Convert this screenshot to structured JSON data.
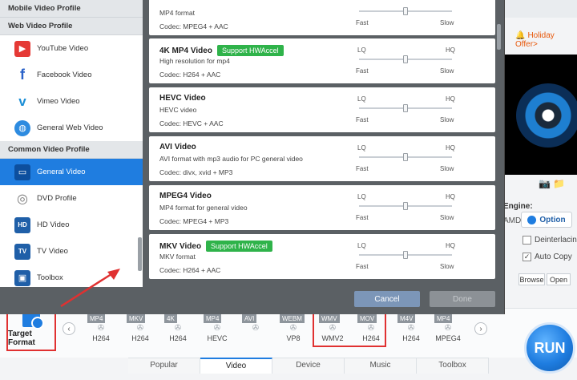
{
  "sidebar": {
    "header_mobile": "Mobile Video Profile",
    "header_web": "Web Video Profile",
    "header_common": "Common Video Profile",
    "web_items": [
      {
        "label": "YouTube Video",
        "icon": "youtube-icon"
      },
      {
        "label": "Facebook Video",
        "icon": "facebook-icon"
      },
      {
        "label": "Vimeo Video",
        "icon": "vimeo-icon"
      },
      {
        "label": "General Web Video",
        "icon": "globe-icon"
      }
    ],
    "common_items": [
      {
        "label": "General Video",
        "icon": "monitor-icon",
        "active": true
      },
      {
        "label": "DVD Profile",
        "icon": "dvd-icon"
      },
      {
        "label": "HD Video",
        "icon": "hd-icon"
      },
      {
        "label": "TV Video",
        "icon": "tv-icon"
      },
      {
        "label": "Toolbox",
        "icon": "toolbox-icon"
      }
    ]
  },
  "profiles": [
    {
      "title": "",
      "hw": "",
      "desc": "MP4 format",
      "codec": "Codec: MPEG4 + AAC",
      "lq": "",
      "hq": "",
      "fast": "Fast",
      "slow": "Slow",
      "quality": 0.5
    },
    {
      "title": "4K MP4 Video",
      "hw": "Support HWAccel",
      "desc": "High resolution for mp4",
      "codec": "Codec: H264 + AAC",
      "lq": "LQ",
      "hq": "HQ",
      "fast": "Fast",
      "slow": "Slow",
      "quality": 0.5
    },
    {
      "title": "HEVC Video",
      "hw": "",
      "desc": "HEVC video",
      "codec": "Codec: HEVC + AAC",
      "lq": "LQ",
      "hq": "HQ",
      "fast": "Fast",
      "slow": "Slow",
      "quality": 0.5
    },
    {
      "title": "AVI Video",
      "hw": "",
      "desc": "AVI format with mp3 audio for PC general video",
      "codec": "Codec: divx, xvid + MP3",
      "lq": "LQ",
      "hq": "HQ",
      "fast": "Fast",
      "slow": "Slow",
      "quality": 0.5
    },
    {
      "title": "MPEG4 Video",
      "hw": "",
      "desc": "MP4 format for general video",
      "codec": "Codec: MPEG4 + MP3",
      "lq": "LQ",
      "hq": "HQ",
      "fast": "Fast",
      "slow": "Slow",
      "quality": 0.5
    },
    {
      "title": "MKV Video",
      "hw": "Support HWAccel",
      "desc": "MKV format",
      "codec": "Codec: H264 + AAC",
      "lq": "LQ",
      "hq": "HQ",
      "fast": "Fast",
      "slow": "Slow",
      "quality": 0.5
    }
  ],
  "dialog": {
    "cancel": "Cancel",
    "done": "Done"
  },
  "app": {
    "holiday": "Holiday Offer>",
    "engine": "Engine:",
    "amd": "AMD",
    "option": "Option",
    "deinterlacing": "Deinterlacing",
    "auto_copy": "Auto Copy",
    "browse": "Browse",
    "open": "Open",
    "target_format": "Target Format",
    "run": "RUN"
  },
  "formats": [
    {
      "top": "MP4",
      "bottom": "H264"
    },
    {
      "top": "MKV",
      "bottom": "H264"
    },
    {
      "top": "4K",
      "bottom": "H264"
    },
    {
      "top": "MP4",
      "bottom": "HEVC"
    },
    {
      "top": "AVI",
      "bottom": ""
    },
    {
      "top": "WEBM",
      "bottom": "VP8"
    },
    {
      "top": "WMV",
      "bottom": "WMV2"
    },
    {
      "top": "MOV",
      "bottom": "H264"
    },
    {
      "top": "M4V",
      "bottom": "H264"
    },
    {
      "top": "MP4",
      "bottom": "MPEG4"
    }
  ],
  "tabs": [
    "Popular",
    "Video",
    "Device",
    "Music",
    "Toolbox"
  ],
  "active_tab": "Video",
  "colors": {
    "accent": "#1f7de0",
    "hwaccel": "#2fb34a",
    "highlight": "#e03131"
  }
}
